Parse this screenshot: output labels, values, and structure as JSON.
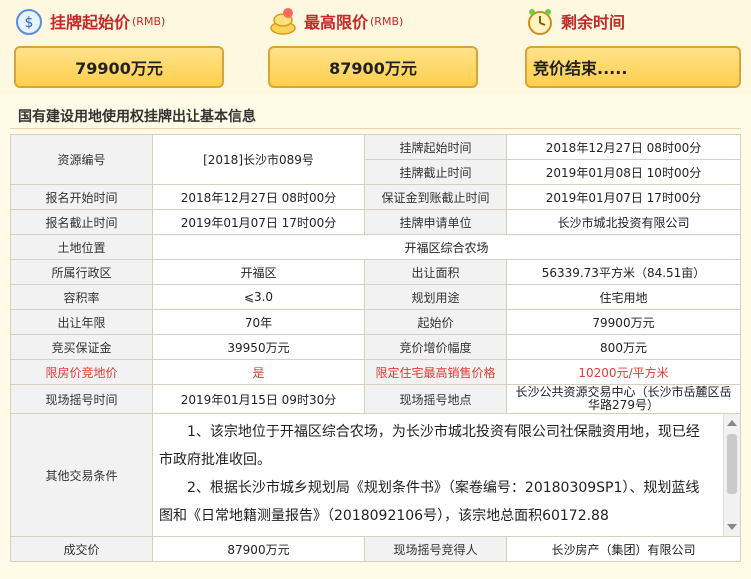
{
  "stats": [
    {
      "title": "挂牌起始价",
      "unit": "(RMB)",
      "value": "79900万元",
      "icon": "money-bag-icon"
    },
    {
      "title": "最高限价",
      "unit": "(RMB)",
      "value": "87900万元",
      "icon": "money-pile-icon"
    },
    {
      "title": "剩余时间",
      "unit": "",
      "value": "竞价结束.....",
      "icon": "alarm-clock-icon"
    }
  ],
  "section_title": "国有建设用地使用权挂牌出让基本信息",
  "rows": [
    {
      "k1": "资源编号",
      "v1": "[2018]长沙市089号",
      "k2": "挂牌起始时间",
      "v2": "2018年12月27日 08时00分"
    },
    {
      "k2b": "挂牌截止时间",
      "v2b": "2019年01月08日 10时00分"
    },
    {
      "k1": "报名开始时间",
      "v1": "2018年12月27日 08时00分",
      "k2": "保证金到账截止时间",
      "v2": "2019年01月07日 17时00分"
    },
    {
      "k1": "报名截止时间",
      "v1": "2019年01月07日 17时00分",
      "k2": "挂牌申请单位",
      "v2": "长沙市城北投资有限公司"
    },
    {
      "k1": "土地位置",
      "v1": "开福区综合农场"
    },
    {
      "k1": "所属行政区",
      "v1": "开福区",
      "k2": "出让面积",
      "v2": "56339.73平方米（84.51亩）"
    },
    {
      "k1": "容积率",
      "v1": "⩽3.0",
      "k2": "规划用途",
      "v2": "住宅用地"
    },
    {
      "k1": "出让年限",
      "v1": "70年",
      "k2": "起始价",
      "v2": "79900万元"
    },
    {
      "k1": "竞买保证金",
      "v1": "39950万元",
      "k2": "竞价增价幅度",
      "v2": "800万元"
    },
    {
      "k1": "限房价竞地价",
      "v1": "是",
      "k2": "限定住宅最高销售价格",
      "v2": "10200元/平方米"
    },
    {
      "k1": "现场摇号时间",
      "v1": "2019年01月15日 09时30分",
      "k2": "现场摇号地点",
      "v2": "长沙公共资源交易中心（长沙市岳麓区岳华路279号）"
    }
  ],
  "other": {
    "label": "其他交易条件",
    "p1": "1、该宗地位于开福区综合农场，为长沙市城北投资有限公司社保融资用地，现已经市政府批准收回。",
    "p2": "2、根据长沙市城乡规划局《规划条件书》（案卷编号：20180309SP1）、规划蓝线图和《日常地籍测量报告》（2018092106号），该宗地总面积60172.88"
  },
  "last": {
    "k1": "成交价",
    "v1": "87900万元",
    "k2": "现场摇号竞得人",
    "v2": "长沙房产（集团）有限公司"
  }
}
